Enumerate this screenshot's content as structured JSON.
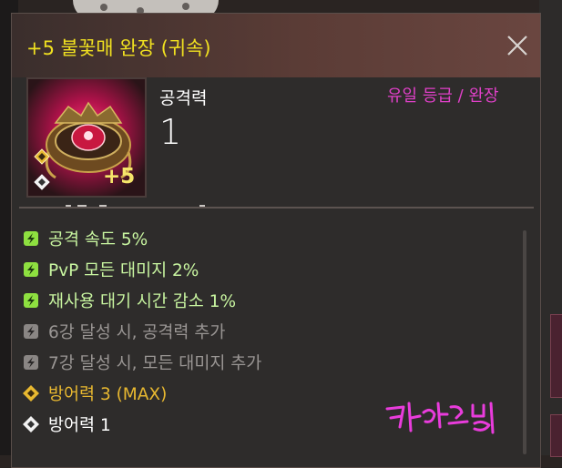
{
  "item": {
    "title": "+5 불꽃매 완장 (귀속)",
    "enhance_badge": "+5",
    "stat_label": "공격력",
    "stat_value": "1",
    "grade": "유일 등급 / 완장"
  },
  "effects": [
    {
      "text": "공격 속도 5%",
      "color": "#c8f5a0",
      "icon": "green-rune-icon"
    },
    {
      "text": "PvP 모든 대미지 2%",
      "color": "#c8f5a0",
      "icon": "green-rune-icon"
    },
    {
      "text": "재사용 대기 시간 감소 1%",
      "color": "#c8f5a0",
      "icon": "green-rune-icon"
    },
    {
      "text": "6강 달성 시, 공격력 추가",
      "color": "#9a9694",
      "icon": "grey-rune-icon"
    },
    {
      "text": "7강 달성 시, 모든 대미지 추가",
      "color": "#9a9694",
      "icon": "grey-rune-icon"
    },
    {
      "text": "방어력 3 (MAX)",
      "color": "#e8b830",
      "icon": "gold-diamond-icon"
    },
    {
      "text": "방어력 1",
      "color": "#ffffff",
      "icon": "white-diamond-icon"
    }
  ],
  "colors": {
    "title": "#f0e020",
    "grade": "#e040c8",
    "signature": "#e93cdc"
  }
}
